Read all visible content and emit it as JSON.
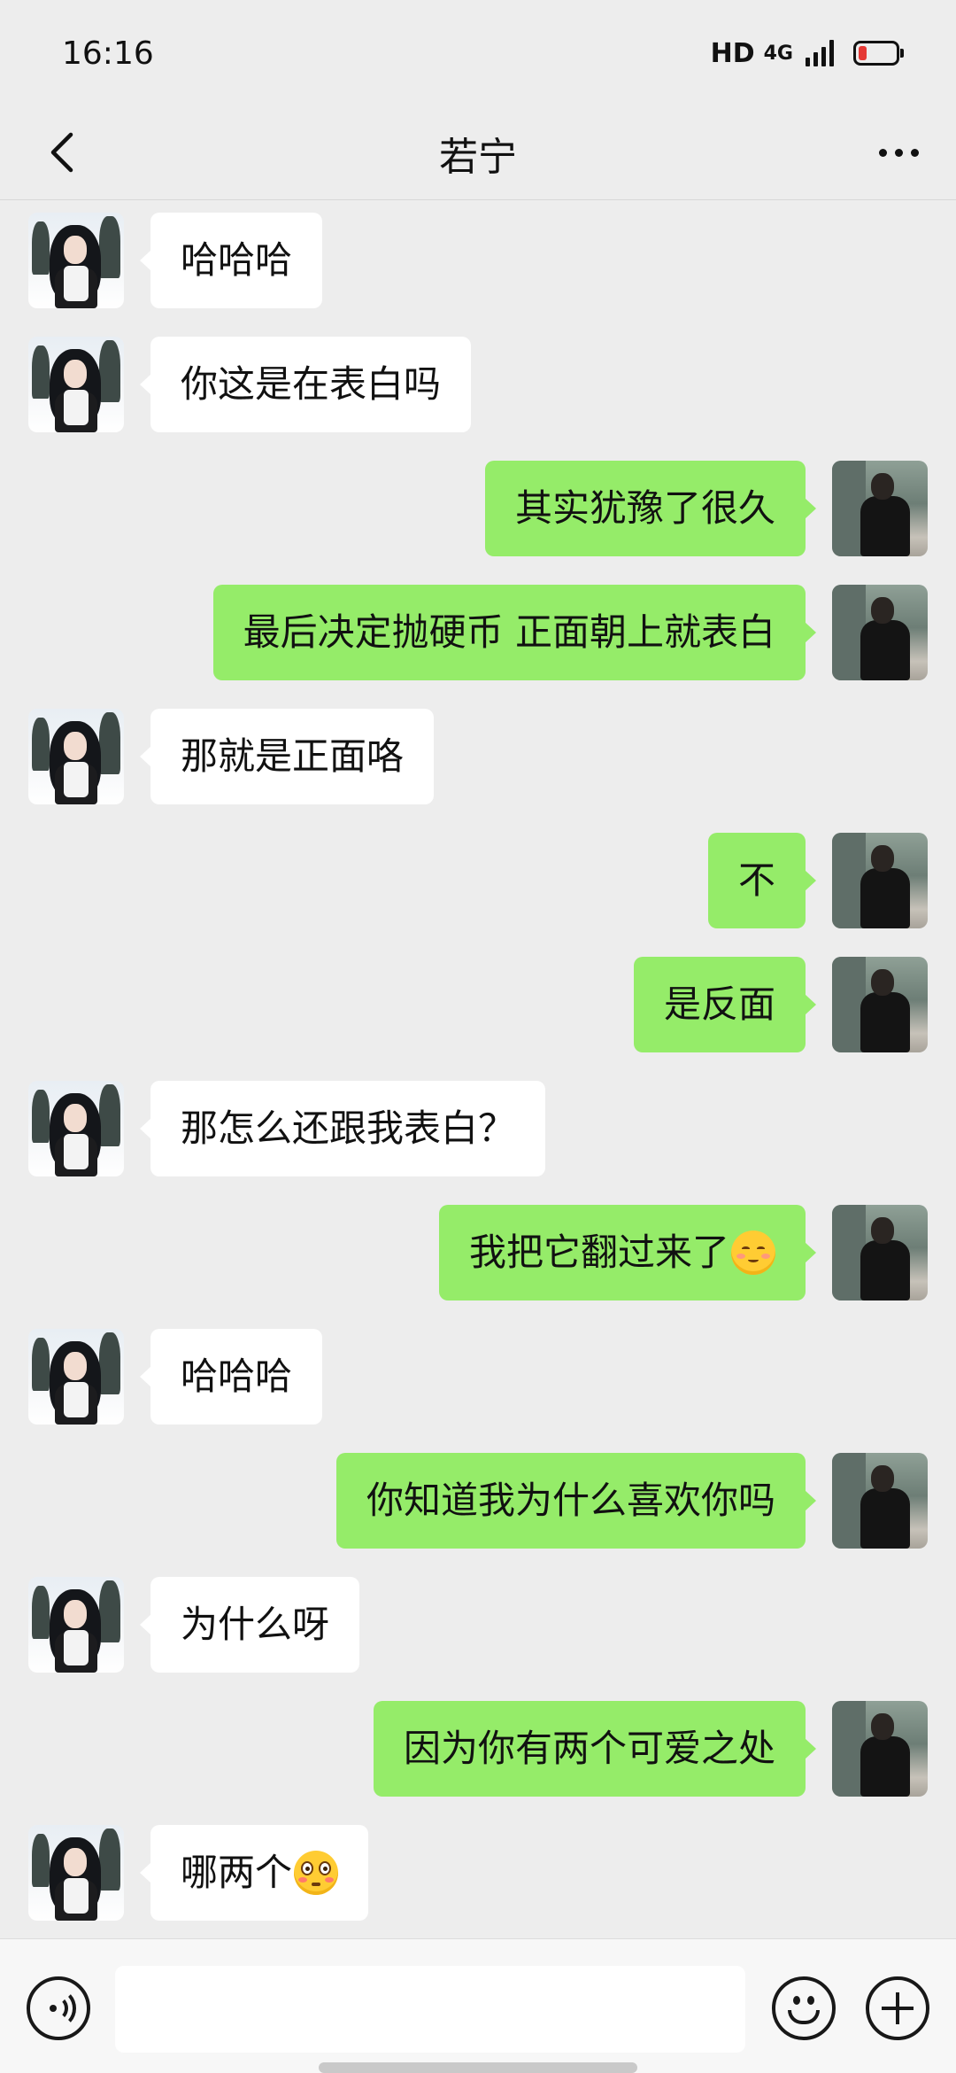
{
  "status_bar": {
    "time": "16:16",
    "hd_label": "HD",
    "network_label": "4G",
    "battery_color": "#e53935"
  },
  "nav": {
    "back_icon": "chevron-left-icon",
    "title": "若宁",
    "more_icon": "more-horizontal-icon"
  },
  "colors": {
    "background": "#ededed",
    "incoming_bubble": "#ffffff",
    "outgoing_bubble": "#95ec69"
  },
  "messages": [
    {
      "side": "left",
      "text": "哈哈哈"
    },
    {
      "side": "left",
      "text": "你这是在表白吗"
    },
    {
      "side": "right",
      "text": "其实犹豫了很久"
    },
    {
      "side": "right",
      "text": "最后决定抛硬币 正面朝上就表白"
    },
    {
      "side": "left",
      "text": "那就是正面咯"
    },
    {
      "side": "right",
      "text": "不"
    },
    {
      "side": "right",
      "text": "是反面"
    },
    {
      "side": "left",
      "text": "那怎么还跟我表白？"
    },
    {
      "side": "right",
      "text": "我把它翻过来了",
      "emoji": "smiling-face-emoji"
    },
    {
      "side": "left",
      "text": "哈哈哈"
    },
    {
      "side": "right",
      "text": "你知道我为什么喜欢你吗"
    },
    {
      "side": "left",
      "text": "为什么呀"
    },
    {
      "side": "right",
      "text": "因为你有两个可爱之处"
    },
    {
      "side": "left",
      "text": "哪两个",
      "emoji": "flushed-face-emoji"
    }
  ],
  "input_bar": {
    "voice_icon": "voice-input-icon",
    "text_value": "",
    "emoji_icon": "emoji-icon",
    "plus_icon": "plus-icon"
  }
}
